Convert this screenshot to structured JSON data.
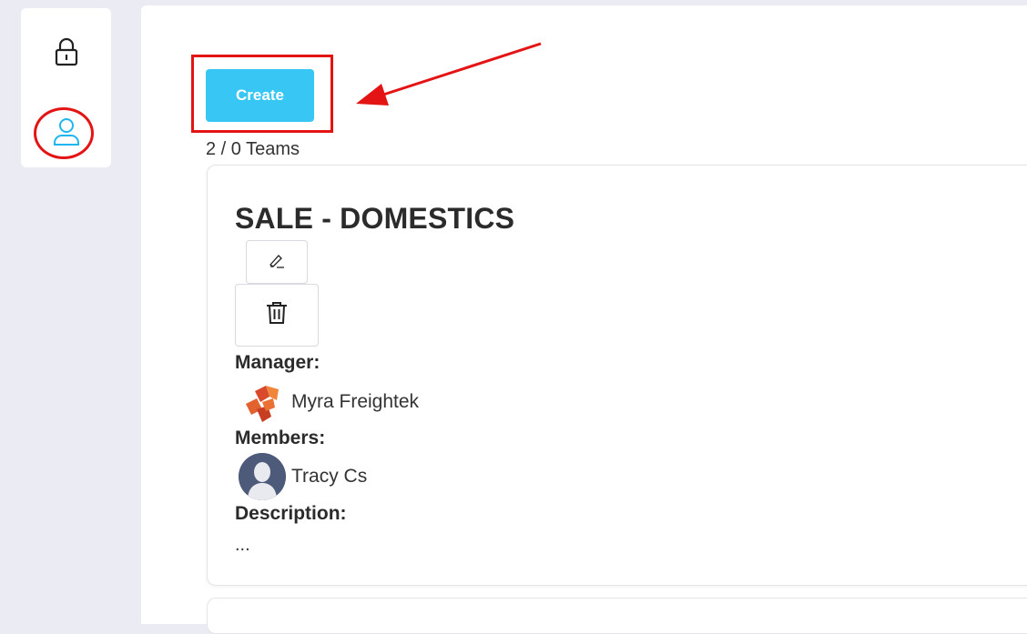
{
  "sidebar": {
    "items": [
      {
        "icon": "lock-icon",
        "label": ""
      },
      {
        "icon": "user-icon",
        "label": ""
      }
    ],
    "active_color": "#1fb6f0"
  },
  "toolbar": {
    "create_label": "Create",
    "create_color": "#38c6f4"
  },
  "teams": {
    "count_text": "2 / 0 Teams"
  },
  "team_card": {
    "name": "SALE - DOMESTICS",
    "edit_icon": "pencil-icon",
    "delete_icon": "trash-icon",
    "manager_label": "Manager:",
    "manager_name": "Myra Freightek",
    "members_label": "Members:",
    "member_name": "Tracy Cs",
    "description_label": "Description:",
    "description_value": "..."
  },
  "annotation_color": "#e51414"
}
